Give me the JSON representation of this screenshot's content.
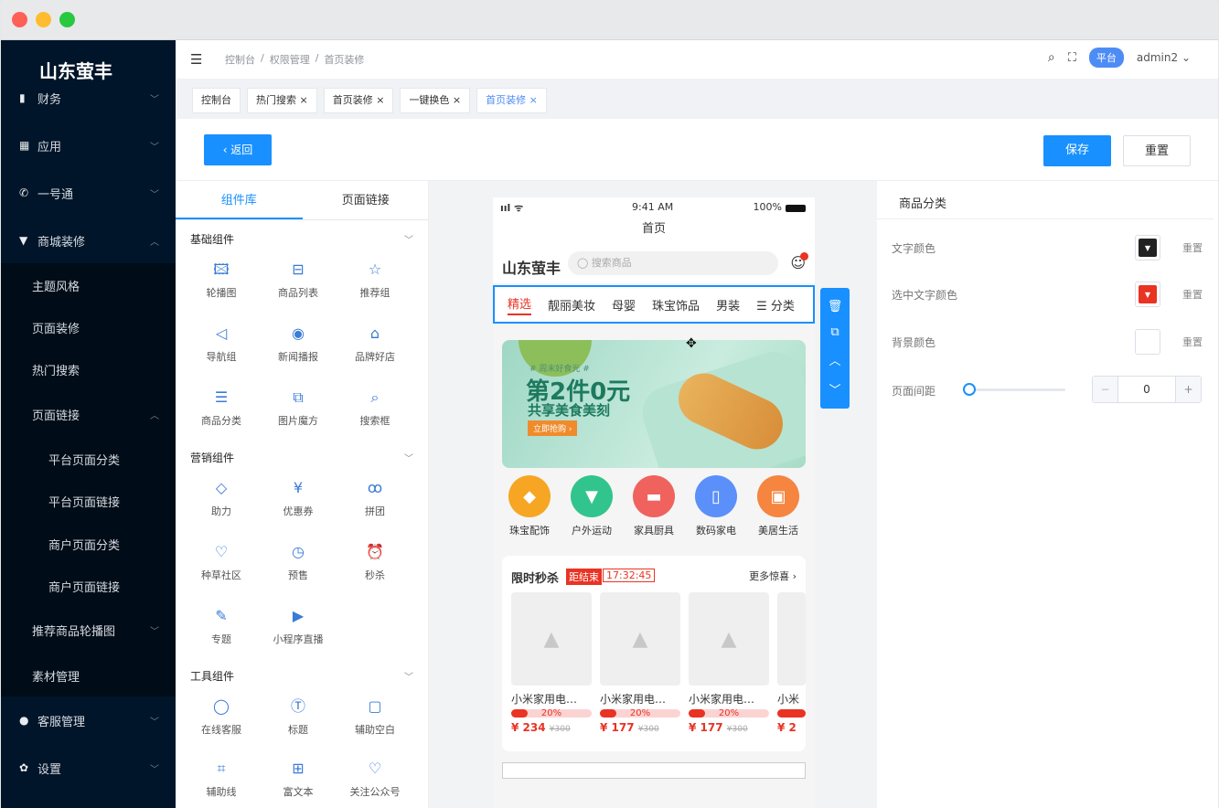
{
  "brand": "山东萤丰",
  "sidebar": {
    "items": [
      {
        "label": "财务",
        "icon": "bar-chart-icon"
      },
      {
        "label": "应用",
        "icon": "grid-icon"
      },
      {
        "label": "一号通",
        "icon": "phone-icon"
      },
      {
        "label": "商城装修",
        "icon": "shop-icon"
      }
    ],
    "sub": [
      "主题风格",
      "页面装修",
      "热门搜索",
      "页面链接"
    ],
    "sub2": [
      "平台页面分类",
      "平台页面链接",
      "商户页面分类",
      "商户页面链接"
    ],
    "sub_after": [
      "推荐商品轮播图",
      "素材管理"
    ],
    "bottom": [
      {
        "label": "客服管理",
        "icon": "user-icon"
      },
      {
        "label": "设置",
        "icon": "gear-icon"
      }
    ]
  },
  "header": {
    "breadcrumb": [
      "控制台",
      "/",
      "权限管理",
      "/",
      "首页装修"
    ],
    "badge": "平台",
    "user": "admin2"
  },
  "tabs": [
    "控制台",
    "热门搜索 ×",
    "首页装修 ×",
    "一键换色 ×",
    "首页装修 ×"
  ],
  "toolbar": {
    "back": "‹ 返回",
    "save": "保存",
    "reset": "重置"
  },
  "library": {
    "tabs": [
      "组件库",
      "页面链接"
    ],
    "groups": [
      {
        "title": "基础组件",
        "items": [
          "轮播图",
          "商品列表",
          "推荐组",
          "导航组",
          "新闻播报",
          "品牌好店",
          "商品分类",
          "图片魔方",
          "搜索框"
        ]
      },
      {
        "title": "营销组件",
        "items": [
          "助力",
          "优惠券",
          "拼团",
          "种草社区",
          "预售",
          "秒杀",
          "专题",
          "小程序直播"
        ]
      },
      {
        "title": "工具组件",
        "items": [
          "在线客服",
          "标题",
          "辅助空白",
          "辅助线",
          "富文本",
          "关注公众号"
        ]
      }
    ]
  },
  "phone": {
    "status": {
      "signal": "ııl ᯤ",
      "time": "9:41 AM",
      "battery": "100%"
    },
    "title": "首页",
    "shop": "山东萤丰",
    "search_placeholder": "搜索商品",
    "cats": [
      "精选",
      "靓丽美妆",
      "母婴",
      "珠宝饰品",
      "男装",
      "分类"
    ],
    "banner": {
      "tag": "# 周末好食光 #",
      "headline": "第2件0元",
      "sub": "共享美食美刻",
      "cta": "立即抢购 ›"
    },
    "icons": [
      {
        "label": "珠宝配饰",
        "color": "#f6a623"
      },
      {
        "label": "户外运动",
        "color": "#32c48d"
      },
      {
        "label": "家具厨具",
        "color": "#f0625e"
      },
      {
        "label": "数码家电",
        "color": "#5b8ff9"
      },
      {
        "label": "美居生活",
        "color": "#f5853f"
      }
    ],
    "seckill": {
      "title": "限时秒杀",
      "tag": "距结束",
      "timer": "17:32:45",
      "more": "更多惊喜 ›",
      "products": [
        {
          "name": "小米家用电…",
          "progress": "20%",
          "price": "¥ 234",
          "old": "¥300"
        },
        {
          "name": "小米家用电…",
          "progress": "20%",
          "price": "¥ 177",
          "old": "¥300"
        },
        {
          "name": "小米家用电…",
          "progress": "20%",
          "price": "¥ 177",
          "old": "¥300"
        },
        {
          "name": "小米",
          "progress": "",
          "price": "¥ 2",
          "old": ""
        }
      ]
    }
  },
  "props": {
    "title": "商品分类",
    "rows": [
      {
        "label": "文字颜色",
        "color": "#222222",
        "reset": "重置"
      },
      {
        "label": "选中文字颜色",
        "color": "#e93323",
        "reset": "重置"
      },
      {
        "label": "背景颜色",
        "color": "#ffffff",
        "reset": "重置"
      }
    ],
    "spacing": {
      "label": "页面间距",
      "value": "0",
      "minus": "−",
      "plus": "+"
    }
  }
}
